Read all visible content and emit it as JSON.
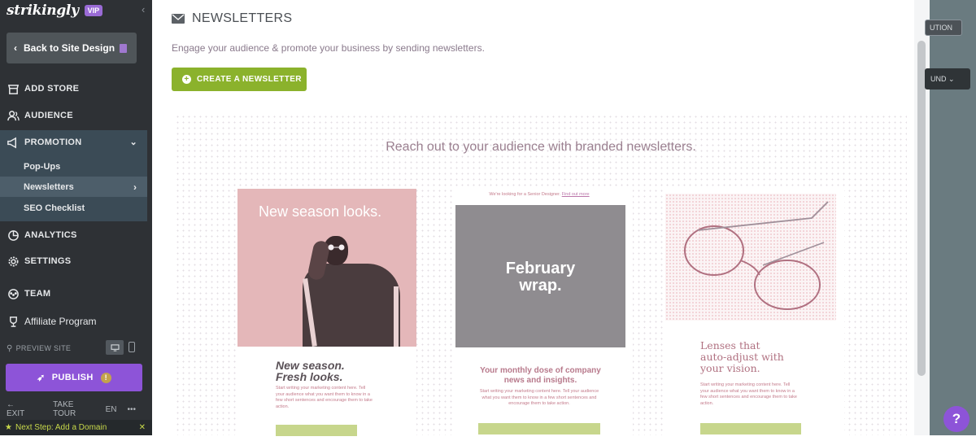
{
  "sidebar": {
    "brand": "strikingly",
    "vip": "VIP",
    "back_label": "Back to Site Design",
    "items": {
      "add_store": "ADD STORE",
      "audience": "AUDIENCE",
      "promotion": "PROMOTION",
      "analytics": "ANALYTICS",
      "settings": "SETTINGS",
      "team": "TEAM",
      "affiliate": "Affiliate Program"
    },
    "promotion_sub": {
      "popups": "Pop-Ups",
      "newsletters": "Newsletters",
      "seo": "SEO Checklist"
    },
    "preview_label": "PREVIEW SITE",
    "publish_label": "PUBLISH",
    "publish_alert": "!",
    "bottom": {
      "exit": "EXIT",
      "tour": "TAKE TOUR",
      "lang": "EN",
      "more": "•••"
    },
    "next_step": "Next Step: Add a Domain"
  },
  "main": {
    "title": "NEWSLETTERS",
    "subtitle": "Engage your audience & promote your business by sending newsletters.",
    "create_label": "CREATE A NEWSLETTER",
    "reach": "Reach out to your audience with branded newsletters.",
    "cards": [
      {
        "image_title": "New season looks.",
        "subtitle_line1": "New season.",
        "subtitle_line2": "Fresh looks.",
        "body": "Start writing your marketing content here. Tell your audience what you want them to know in a few short sentences and encourage them to take action."
      },
      {
        "tag": "We're looking for a Senior Designer.",
        "tag_link": "Find out more",
        "image_line1": "February",
        "image_line2": "wrap.",
        "subtitle_line1": "Your monthly dose of company",
        "subtitle_line2": "news and insights.",
        "body": "Start writing your marketing content here. Tell your audience what you want them to know in a few short sentences and encourage them to take action."
      },
      {
        "subtitle_line1": "Lenses that",
        "subtitle_line2": "auto-adjust with",
        "subtitle_line3": "your vision.",
        "body": "Start writing your marketing content here. Tell your audience what you want them to know in a few short sentences and encourage them to take action."
      }
    ]
  },
  "right_panel": {
    "pill1": "UTION",
    "pill2": "UND ⌄"
  },
  "help_label": "?"
}
